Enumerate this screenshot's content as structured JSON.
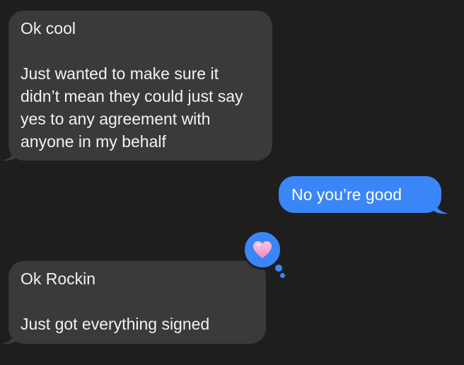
{
  "messages": [
    {
      "direction": "incoming",
      "text": "Ok cool\n\nJust wanted to make sure it didn’t mean they could just say yes to any agreement with anyone in my behalf"
    },
    {
      "direction": "outgoing",
      "text": "No you’re good"
    },
    {
      "direction": "incoming",
      "text": "Ok Rockin\n\nJust got everything signed",
      "tapback": "heart"
    }
  ],
  "colors": {
    "background": "#1e1e1e",
    "incoming_bubble": "#3a3a3c",
    "outgoing_bubble": "#3a86f6",
    "tapback_heart": "#f7a6cf"
  }
}
